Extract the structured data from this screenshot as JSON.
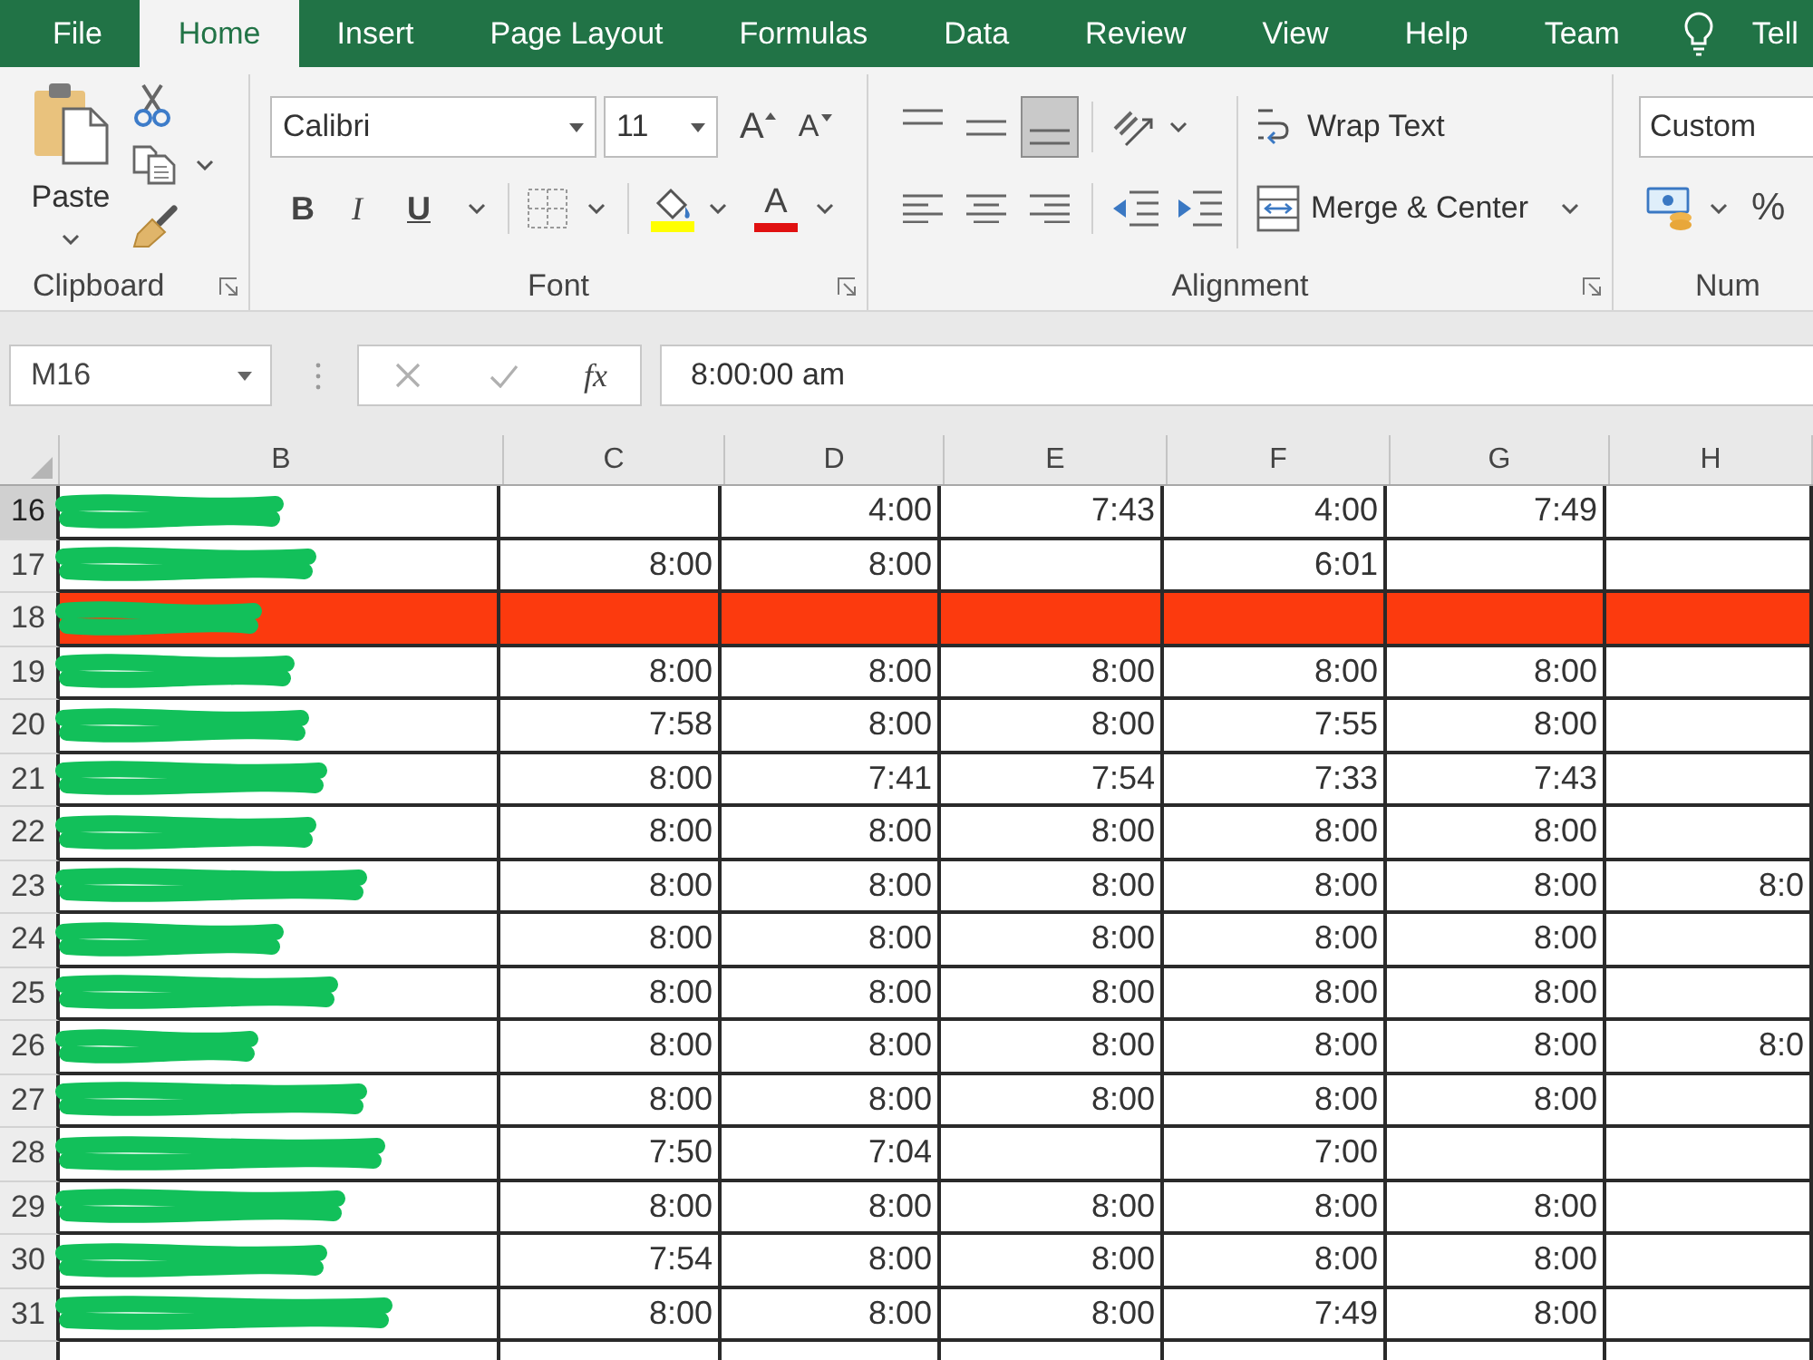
{
  "ribbon_tabs": [
    {
      "label": "File",
      "selected": false
    },
    {
      "label": "Home",
      "selected": true
    },
    {
      "label": "Insert",
      "selected": false
    },
    {
      "label": "Page Layout",
      "selected": false
    },
    {
      "label": "Formulas",
      "selected": false
    },
    {
      "label": "Data",
      "selected": false
    },
    {
      "label": "Review",
      "selected": false
    },
    {
      "label": "View",
      "selected": false
    },
    {
      "label": "Help",
      "selected": false
    },
    {
      "label": "Team",
      "selected": false
    }
  ],
  "tell_me": {
    "label": "Tell"
  },
  "ribbon": {
    "clipboard": {
      "title": "Clipboard",
      "paste_label": "Paste"
    },
    "font": {
      "title": "Font",
      "font_name": "Calibri",
      "font_size": "11",
      "grow_label": "A",
      "shrink_label": "A",
      "style_buttons": [
        {
          "kind": "bold",
          "label": "B"
        },
        {
          "kind": "italic",
          "label": "I"
        },
        {
          "kind": "underline",
          "label": "U"
        }
      ],
      "font_color_label": "A"
    },
    "alignment": {
      "title": "Alignment",
      "vertical": [
        {
          "kind": "top",
          "selected": false
        },
        {
          "kind": "middle",
          "selected": false
        },
        {
          "kind": "bottom",
          "selected": true
        }
      ],
      "horizontal": [
        {
          "kind": "left",
          "selected": false
        },
        {
          "kind": "center",
          "selected": false
        },
        {
          "kind": "right",
          "selected": false
        }
      ],
      "wrap_label": "Wrap Text",
      "merge_label": "Merge & Center"
    },
    "number": {
      "title": "Num",
      "format": "Custom",
      "percent_label": "%"
    }
  },
  "formula_bar": {
    "name_box": "M16",
    "function_label": "fx",
    "value": "8:00:00 am"
  },
  "sheet": {
    "columns": [
      "B",
      "C",
      "D",
      "E",
      "F",
      "G",
      "H"
    ],
    "rows": [
      {
        "number": "16",
        "active": true,
        "redacted": true,
        "highlighted": false,
        "cells": [
          null,
          "4:00",
          "7:43",
          "4:00",
          "7:49",
          null
        ]
      },
      {
        "number": "17",
        "active": false,
        "redacted": true,
        "highlighted": false,
        "cells": [
          "8:00",
          "8:00",
          null,
          "6:01",
          null,
          null
        ]
      },
      {
        "number": "18",
        "active": false,
        "redacted": true,
        "highlighted": true,
        "cells": [
          null,
          null,
          null,
          null,
          null,
          null
        ]
      },
      {
        "number": "19",
        "active": false,
        "redacted": true,
        "highlighted": false,
        "cells": [
          "8:00",
          "8:00",
          "8:00",
          "8:00",
          "8:00",
          null
        ]
      },
      {
        "number": "20",
        "active": false,
        "redacted": true,
        "highlighted": false,
        "cells": [
          "7:58",
          "8:00",
          "8:00",
          "7:55",
          "8:00",
          null
        ]
      },
      {
        "number": "21",
        "active": false,
        "redacted": true,
        "highlighted": false,
        "cells": [
          "8:00",
          "7:41",
          "7:54",
          "7:33",
          "7:43",
          null
        ]
      },
      {
        "number": "22",
        "active": false,
        "redacted": true,
        "highlighted": false,
        "cells": [
          "8:00",
          "8:00",
          "8:00",
          "8:00",
          "8:00",
          null
        ]
      },
      {
        "number": "23",
        "active": false,
        "redacted": true,
        "highlighted": false,
        "cells": [
          "8:00",
          "8:00",
          "8:00",
          "8:00",
          "8:00",
          "8:0"
        ]
      },
      {
        "number": "24",
        "active": false,
        "redacted": true,
        "highlighted": false,
        "cells": [
          "8:00",
          "8:00",
          "8:00",
          "8:00",
          "8:00",
          null
        ]
      },
      {
        "number": "25",
        "active": false,
        "redacted": true,
        "highlighted": false,
        "cells": [
          "8:00",
          "8:00",
          "8:00",
          "8:00",
          "8:00",
          null
        ]
      },
      {
        "number": "26",
        "active": false,
        "redacted": true,
        "highlighted": false,
        "cells": [
          "8:00",
          "8:00",
          "8:00",
          "8:00",
          "8:00",
          "8:0"
        ]
      },
      {
        "number": "27",
        "active": false,
        "redacted": true,
        "highlighted": false,
        "cells": [
          "8:00",
          "8:00",
          "8:00",
          "8:00",
          "8:00",
          null
        ]
      },
      {
        "number": "28",
        "active": false,
        "redacted": true,
        "highlighted": false,
        "cells": [
          "7:50",
          "7:04",
          null,
          "7:00",
          null,
          null
        ]
      },
      {
        "number": "29",
        "active": false,
        "redacted": true,
        "highlighted": false,
        "cells": [
          "8:00",
          "8:00",
          "8:00",
          "8:00",
          "8:00",
          null
        ]
      },
      {
        "number": "30",
        "active": false,
        "redacted": true,
        "highlighted": false,
        "cells": [
          "7:54",
          "8:00",
          "8:00",
          "8:00",
          "8:00",
          null
        ]
      },
      {
        "number": "31",
        "active": false,
        "redacted": true,
        "highlighted": false,
        "cells": [
          "8:00",
          "8:00",
          "8:00",
          "7:49",
          "8:00",
          null
        ]
      }
    ]
  }
}
